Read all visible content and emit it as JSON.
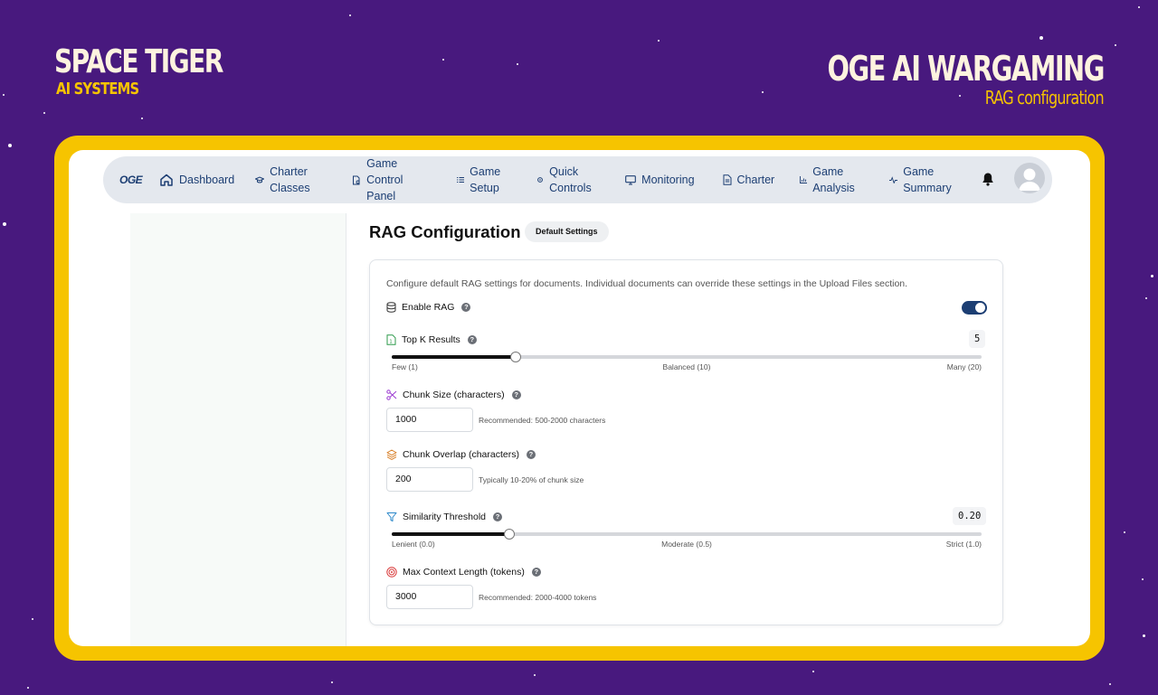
{
  "brand": {
    "left_title": "SPACE TIGER",
    "left_subtitle": "AI SYSTEMS",
    "right_title": "OGE AI WARGAMING",
    "right_subtitle": "RAG configuration"
  },
  "colors": {
    "background": "#48197e",
    "frame": "#f6c400",
    "accent": "#1c3e73"
  },
  "nav": {
    "logo": "OGE",
    "items": [
      {
        "label": "Dashboard",
        "icon": "home-icon"
      },
      {
        "label": "Charter Classes",
        "icon": "graduation-cap-icon"
      },
      {
        "label": "Game Control Panel",
        "icon": "document-gear-icon"
      },
      {
        "label": "Game Setup",
        "icon": "list-icon"
      },
      {
        "label": "Quick Controls",
        "icon": "gear-icon"
      },
      {
        "label": "Monitoring",
        "icon": "monitor-icon"
      },
      {
        "label": "Charter",
        "icon": "document-icon"
      },
      {
        "label": "Game Analysis",
        "icon": "bar-chart-icon"
      },
      {
        "label": "Game Summary",
        "icon": "activity-icon"
      }
    ]
  },
  "page": {
    "title": "RAG Configuration",
    "badge": "Default Settings"
  },
  "rag": {
    "description": "Configure default RAG settings for documents. Individual documents can override these settings in the Upload Files section.",
    "enable": {
      "label": "Enable RAG",
      "on": true
    },
    "top_k": {
      "label": "Top K Results",
      "value": "5",
      "fraction": 0.21,
      "min_label": "Few (1)",
      "mid_label": "Balanced (10)",
      "max_label": "Many (20)"
    },
    "chunk_size": {
      "label": "Chunk Size (characters)",
      "value": "1000",
      "hint": "Recommended: 500-2000 characters"
    },
    "chunk_overlap": {
      "label": "Chunk Overlap (characters)",
      "value": "200",
      "hint": "Typically 10-20% of chunk size"
    },
    "similarity": {
      "label": "Similarity Threshold",
      "value": "0.20",
      "fraction": 0.2,
      "min_label": "Lenient (0.0)",
      "mid_label": "Moderate (0.5)",
      "max_label": "Strict (1.0)"
    },
    "max_context": {
      "label": "Max Context Length (tokens)",
      "value": "3000",
      "hint": "Recommended: 2000-4000 tokens"
    }
  }
}
